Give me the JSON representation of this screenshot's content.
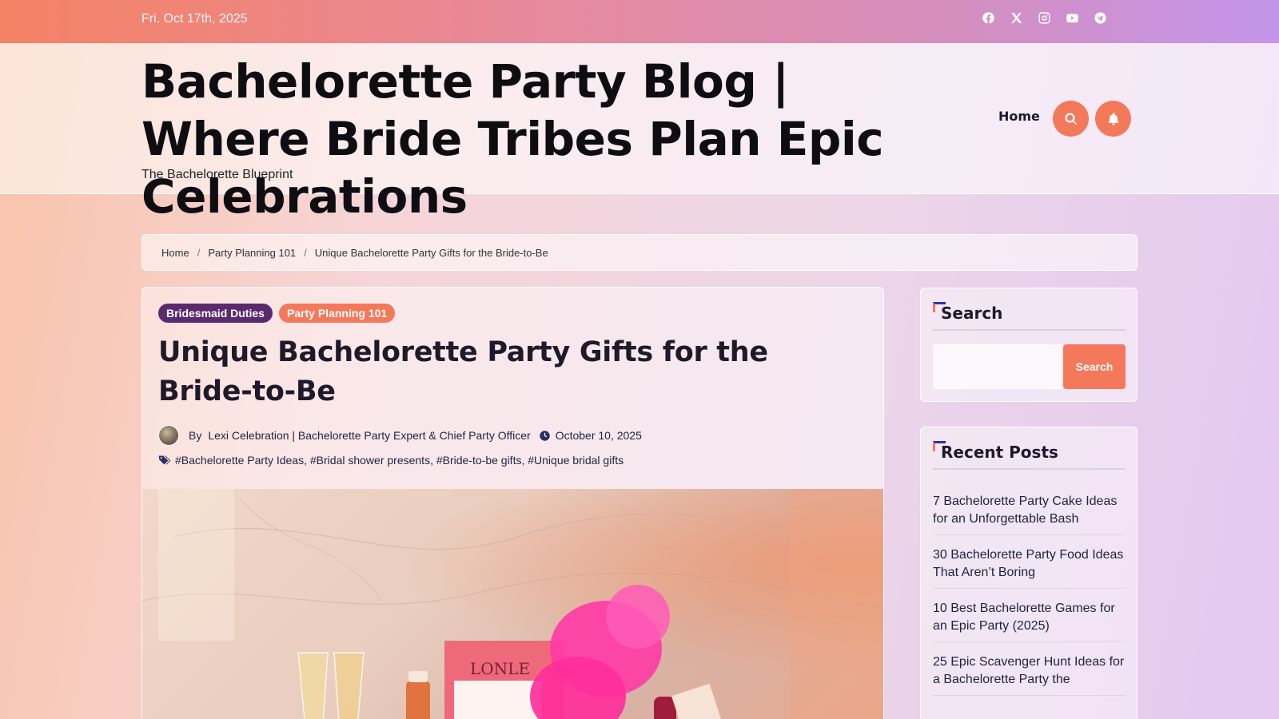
{
  "topbar": {
    "date": "Fri. Oct 17th, 2025",
    "socials": [
      {
        "icon": "facebook-icon"
      },
      {
        "icon": "x-twitter-icon"
      },
      {
        "icon": "instagram-icon"
      },
      {
        "icon": "youtube-icon"
      },
      {
        "icon": "telegram-icon"
      }
    ]
  },
  "header": {
    "title": "Bachelorette Party Blog | Where Bride Tribes Plan Epic Celebrations",
    "tagline": "The Bachelorette Blueprint",
    "nav": {
      "home": "Home"
    }
  },
  "breadcrumb": {
    "items": [
      "Home",
      "Party Planning 101",
      "Unique Bachelorette Party Gifts for the Bride-to-Be"
    ],
    "separator": "/"
  },
  "post": {
    "categories": [
      "Bridesmaid Duties",
      "Party Planning 101"
    ],
    "title": "Unique Bachelorette Party Gifts for the Bride-to-Be",
    "by_label": "By",
    "author": "Lexi Celebration | Bachelorette Party Expert & Chief Party Officer",
    "date": "October 10, 2025",
    "tags": [
      "#Bachelorette Party Ideas",
      "#Bridal shower presents",
      "#Bride-to-be gifts",
      "#Unique bridal gifts"
    ]
  },
  "sidebar": {
    "search": {
      "title": "Search",
      "button": "Search",
      "placeholder": ""
    },
    "recent": {
      "title": "Recent Posts",
      "items": [
        "7 Bachelorette Party Cake Ideas for an Unforgettable Bash",
        "30 Bachelorette Party Food Ideas That Aren’t Boring",
        "10 Best Bachelorette Games for an Epic Party (2025)",
        "25 Epic Scavenger Hunt Ideas for a Bachelorette Party the"
      ]
    }
  },
  "colors": {
    "accent": "#f4795b",
    "category_purple": "#5b2a6e",
    "title_corner_blue": "#2a2fb0"
  }
}
